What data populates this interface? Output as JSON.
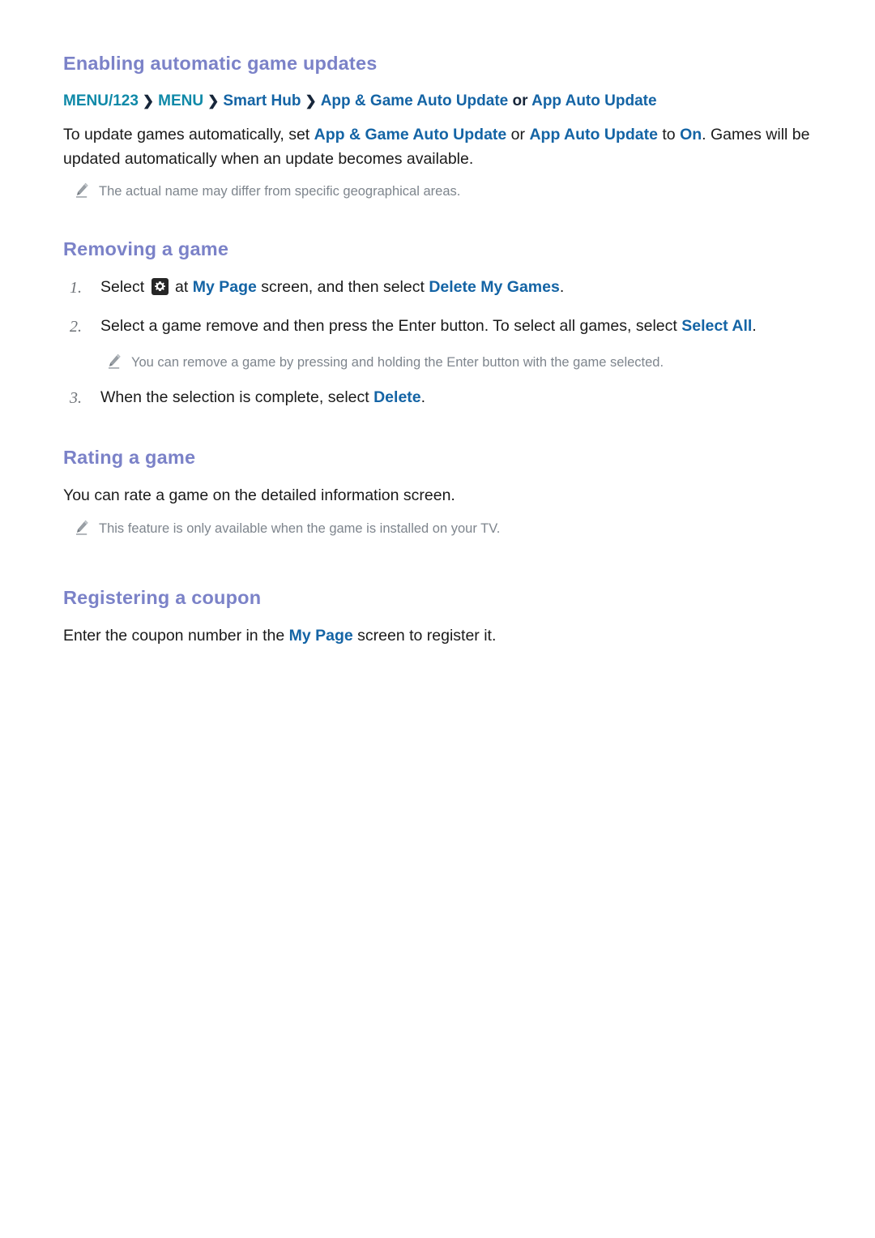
{
  "sections": [
    {
      "id": "enabling-automatic-game-updates",
      "heading": "Enabling automatic game updates",
      "menu_path": {
        "items": [
          {
            "label": "MENU/123",
            "style": "teal"
          },
          {
            "label": "MENU",
            "style": "teal"
          },
          {
            "label": "Smart Hub",
            "style": "blue"
          },
          {
            "label": "App & Game Auto Update",
            "style": "blue"
          }
        ],
        "separator": "❯",
        "or_word": "or",
        "alt_label": "App Auto Update"
      },
      "body": {
        "part1": "To update games automatically, set ",
        "link1": "App & Game Auto Update",
        "part2": " or ",
        "link2": "App Auto Update",
        "part3": " to ",
        "link3": "On",
        "part4": ". Games will be updated automatically when an update becomes available."
      },
      "note": {
        "icon": "pencil-icon",
        "text": "The actual name may differ from specific geographical areas."
      }
    },
    {
      "id": "removing-a-game",
      "heading": "Removing a game",
      "steps": [
        {
          "number": "1.",
          "pre_icon": "Select ",
          "icon": "gear-icon",
          "part1": " at ",
          "link1": "My Page",
          "part2": " screen, and then select ",
          "link2": "Delete My Games",
          "part3": "."
        },
        {
          "number": "2.",
          "part1": "Select a game remove and then press the Enter button. To select all games, select ",
          "link1": "Select All",
          "part2": "."
        },
        {
          "number": "3.",
          "part1": "When the selection is complete, select ",
          "link1": "Delete",
          "part2": "."
        }
      ],
      "note": {
        "icon": "pencil-icon",
        "text": "You can remove a game by pressing and holding the Enter button with the game selected."
      }
    },
    {
      "id": "rating-a-game",
      "heading": "Rating a game",
      "body_text": "You can rate a game on the detailed information screen.",
      "note": {
        "icon": "pencil-icon",
        "text": "This feature is only available when the game is installed on your TV."
      }
    },
    {
      "id": "registering-a-coupon",
      "heading": "Registering a coupon",
      "body": {
        "part1": "Enter the coupon number in the ",
        "link1": "My Page",
        "part2": " screen to register it."
      }
    }
  ],
  "colors": {
    "heading": "#7b82c8",
    "teal_link": "#0f89a8",
    "blue_link": "#1464a5",
    "body_text": "#1a1a1a",
    "note_text": "#7e858d",
    "step_number": "#6e7277",
    "page_background": "#ffffff"
  }
}
